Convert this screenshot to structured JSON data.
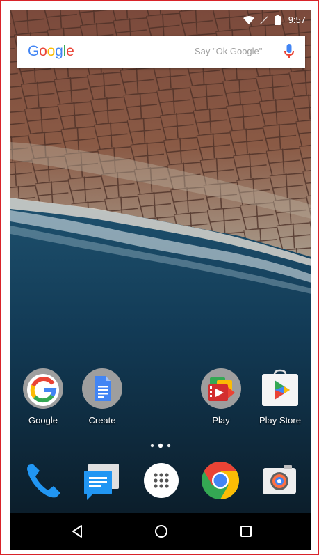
{
  "status_bar": {
    "time": "9:57"
  },
  "search": {
    "logo_letters": [
      "G",
      "o",
      "o",
      "g",
      "l",
      "e"
    ],
    "hint": "Say \"Ok Google\""
  },
  "colors": {
    "blue": "#4285f4",
    "red": "#ea4335",
    "yellow": "#fbbc05",
    "green": "#34a853",
    "frame": "#d9232a"
  },
  "home_apps": [
    {
      "label": "Google",
      "icon": "google-app-icon"
    },
    {
      "label": "Create",
      "icon": "create-docs-icon"
    },
    {
      "label": "Play",
      "icon": "play-folder-icon"
    },
    {
      "label": "Play Store",
      "icon": "play-store-icon"
    }
  ],
  "dock": [
    {
      "icon": "phone-icon"
    },
    {
      "icon": "messenger-icon"
    },
    {
      "icon": "app-drawer-icon"
    },
    {
      "icon": "chrome-icon"
    },
    {
      "icon": "camera-icon"
    }
  ],
  "navigation": [
    "back-icon",
    "home-icon",
    "recents-icon"
  ]
}
